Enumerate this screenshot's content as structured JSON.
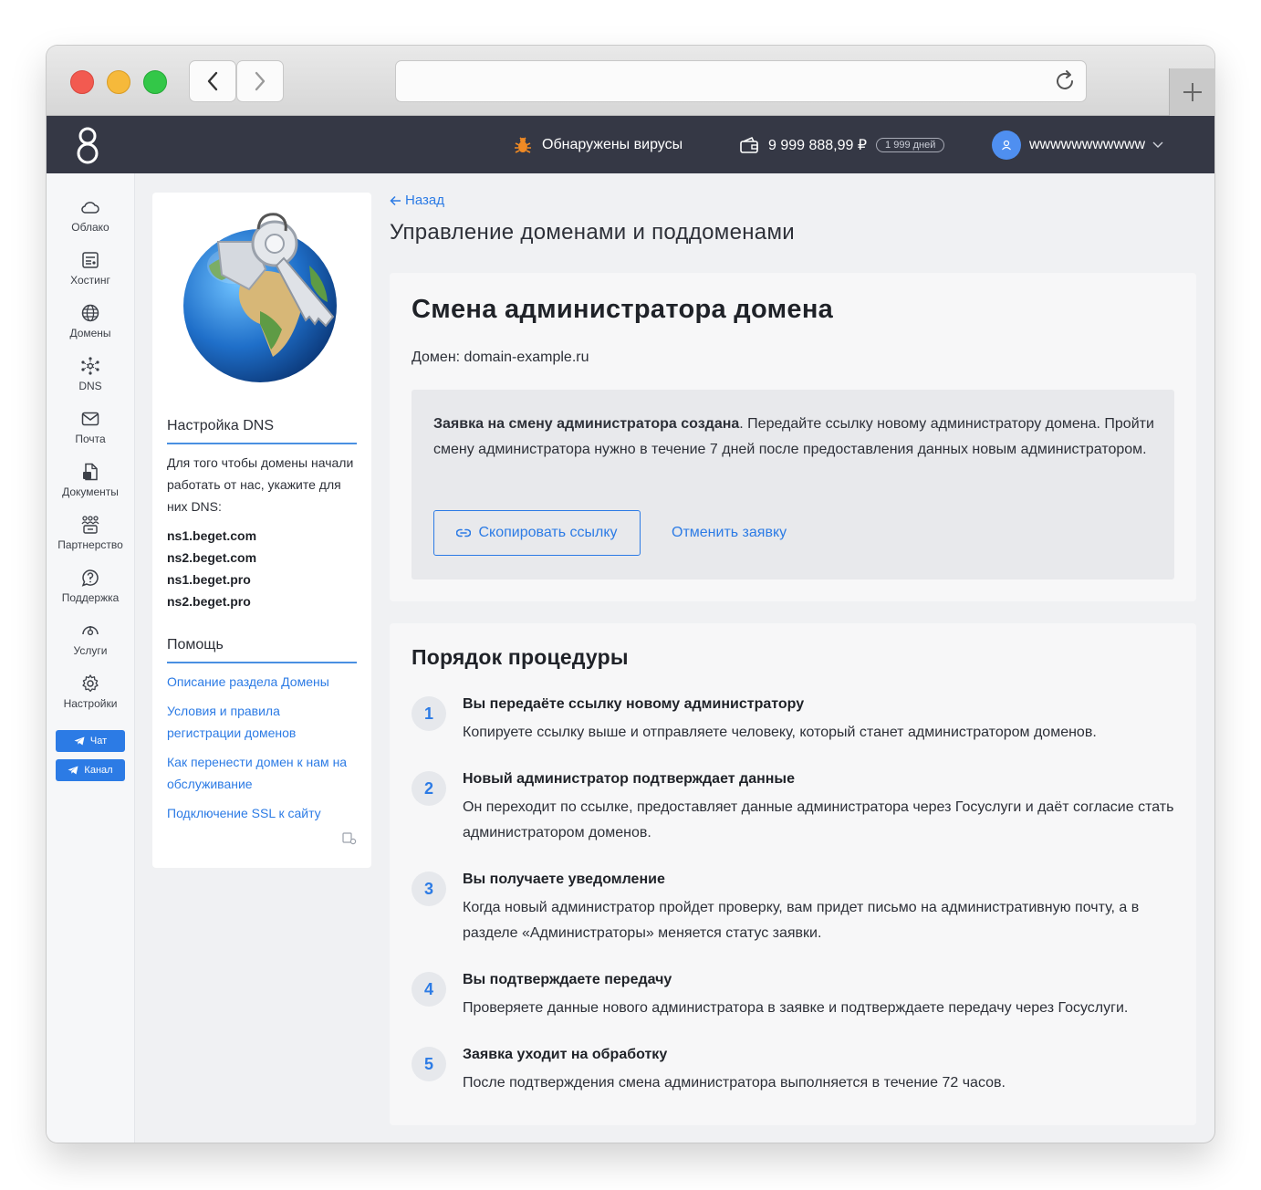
{
  "header": {
    "virus_alert": "Обнаружены вирусы",
    "balance": "9 999 888,99 ₽",
    "days_badge": "1 999 дней",
    "username": "wwwwwwwwwww"
  },
  "sidebar": {
    "items": [
      {
        "label": "Облако",
        "icon": "cloud-icon"
      },
      {
        "label": "Хостинг",
        "icon": "hosting-icon"
      },
      {
        "label": "Домены",
        "icon": "globe-icon"
      },
      {
        "label": "DNS",
        "icon": "dns-icon"
      },
      {
        "label": "Почта",
        "icon": "mail-icon"
      },
      {
        "label": "Документы",
        "icon": "documents-icon"
      },
      {
        "label": "Партнерство",
        "icon": "partners-icon"
      },
      {
        "label": "Поддержка",
        "icon": "support-icon"
      },
      {
        "label": "Услуги",
        "icon": "services-icon"
      },
      {
        "label": "Настройки",
        "icon": "settings-icon"
      }
    ],
    "chat_label": "Чат",
    "channel_label": "Канал"
  },
  "left_panel": {
    "dns_heading": "Настройка DNS",
    "dns_text": "Для того чтобы домены начали работать от нас, укажите для них DNS:",
    "nameservers": [
      "ns1.beget.com",
      "ns2.beget.com",
      "ns1.beget.pro",
      "ns2.beget.pro"
    ],
    "help_heading": "Помощь",
    "help_links": [
      "Описание раздела Домены",
      "Условия и правила регистрации доменов",
      "Как перенести домен к нам на обслуживание",
      "Подключение SSL к сайту"
    ]
  },
  "main": {
    "back_label": "Назад",
    "page_title": "Управление доменами и поддоменами",
    "card_title": "Смена администратора домена",
    "domain_label": "Домен:",
    "domain_value": "domain-example.ru",
    "notice_bold": "Заявка на смену администратора создана",
    "notice_rest": ". Передайте ссылку новому администратору домена. Пройти смену администратора нужно в течение 7 дней после предоставления данных новым администратором.",
    "copy_button": "Скопировать ссылку",
    "cancel_button": "Отменить заявку",
    "procedure_title": "Порядок процедуры",
    "steps": [
      {
        "num": "1",
        "title": "Вы передаёте ссылку новому администратору",
        "desc": "Копируете ссылку выше и отправляете человеку, который станет администратором доменов."
      },
      {
        "num": "2",
        "title": "Новый администратор подтверждает данные",
        "desc": "Он переходит по ссылке, предоставляет данные администратора через Госуслуги и даёт согласие стать администратором доменов."
      },
      {
        "num": "3",
        "title": "Вы получаете уведомление",
        "desc": "Когда новый администратор пройдет проверку, вам придет письмо на административную почту, а в разделе «Администраторы» меняется статус заявки."
      },
      {
        "num": "4",
        "title": "Вы подтверждаете передачу",
        "desc": "Проверяете данные нового администратора в заявке и подтверждаете передачу через Госуслуги."
      },
      {
        "num": "5",
        "title": "Заявка уходит на обработку",
        "desc": "После подтверждения смена администратора выполняется в течение 72 часов."
      }
    ]
  },
  "colors": {
    "accent": "#2c7be5",
    "topbar": "#353845"
  }
}
